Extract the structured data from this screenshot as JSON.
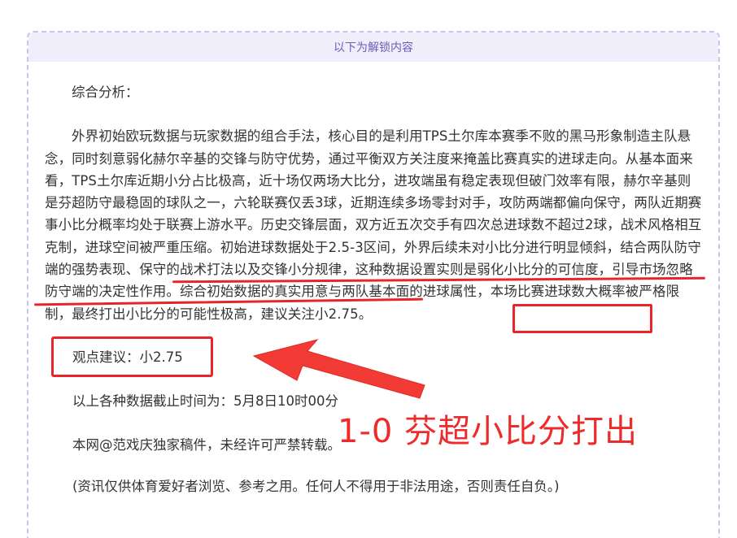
{
  "unlock_header": "以下为解锁内容",
  "heading": "综合分析：",
  "paragraph_before_highlight": "外界初始欧玩数据与玩家数据的组合手法，核心目的是利用TPS土尔库本赛季不败的黑马形象制造主队悬念，同时刻意弱化赫尔辛基的交锋与防守优势，通过平衡双方关注度来掩盖比赛真实的进球走向。从基本面来看，TPS土尔库近期小分占比极高，近十场仅两场大比分，进攻端虽有稳定表现但破门效率有限，赫尔辛基则是芬超防守最稳固的球队之一，六轮联赛仅丢3球，近期连续多场零封对手，攻防两端都偏向保守，两队近期赛事小比分概率均处于联赛上游水平。历史交锋层面，双方近五次交手有四次总进球数不超过2球，战术风格相互克制，进球空间被严重压缩。初始进球数据处于2.5-3区间，外界后续未对小比分进行明显倾斜，",
  "paragraph_highlight": "结合两队防守端的强势表现、保守的战术打法以及交锋小分规律，这种数据设置实则是弱化小比分的可信度，引导市场忽略防守端的决定性作用。",
  "paragraph_after_highlight": "综合初始数据的真实用意与两队基本面的进球属性，本场比赛进球数大概率被严格限制，最终打出小比分的可能性极高，",
  "paragraph_tail": "建议关注小2.75。",
  "viewpoint": "观点建议：小2.75",
  "cutoff_time": "以上各种数据截止时间为：5月8日10时00分",
  "copyright": "本网@范戏庆独家稿件，未经许可严禁转载。",
  "disclaimer": "(资讯仅供体育爱好者浏览、参考之用。任何人不得用于非法用途，否则责任自负。)",
  "annotation_text": "1-0 芬超小比分打出",
  "colors": {
    "annotation_red": "#e8262a",
    "header_bg": "#f1eefb",
    "header_text": "#6a5fb8",
    "dashed_border": "#c9c3ef"
  }
}
